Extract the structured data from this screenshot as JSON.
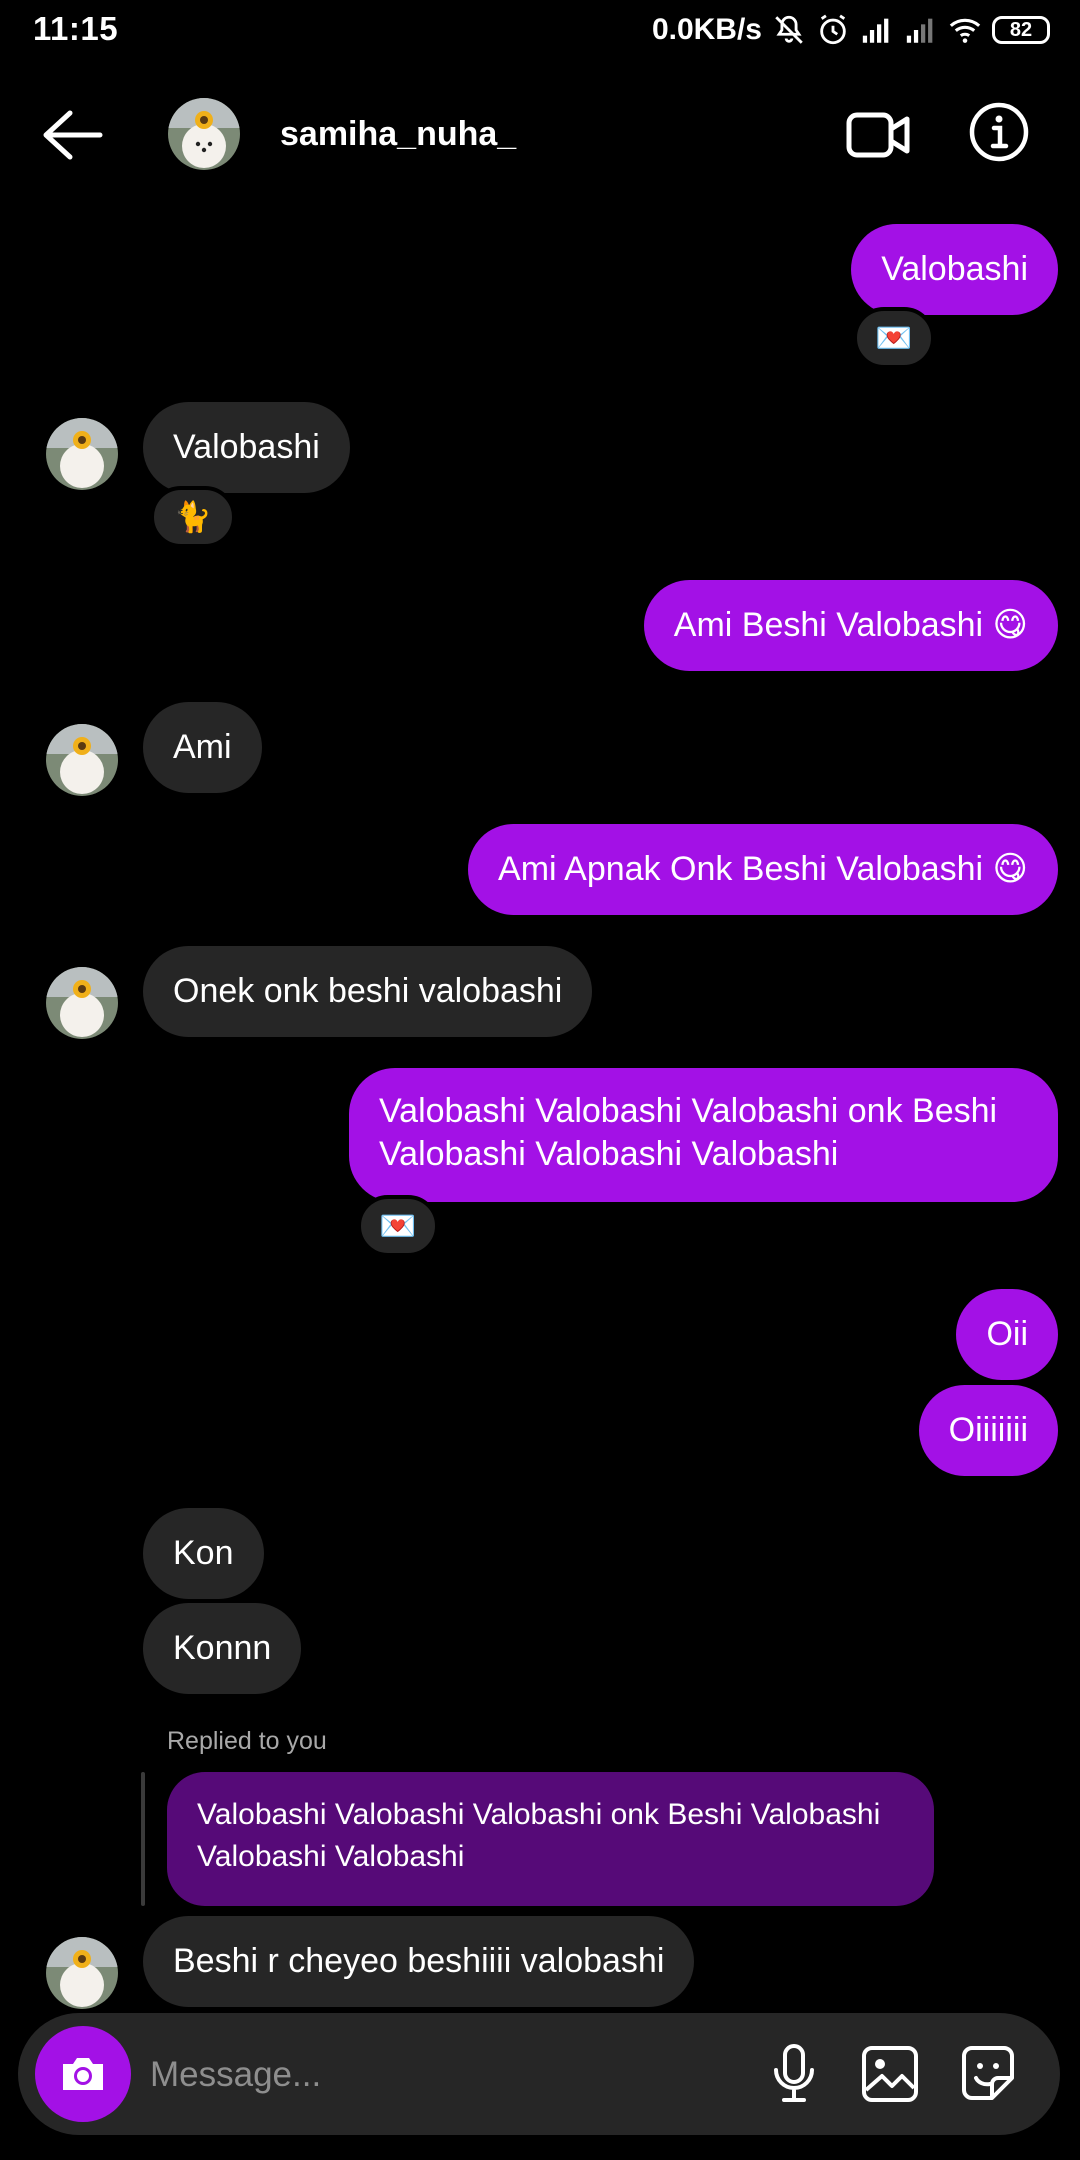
{
  "status_bar": {
    "time": "11:15",
    "net_speed": "0.0KB/s",
    "battery": "82"
  },
  "header": {
    "username": "samiha_nuha_",
    "icons": [
      "back-arrow-icon",
      "video-call-icon",
      "info-icon"
    ]
  },
  "messages": [
    {
      "id": 1,
      "direction": "outgoing",
      "text": "Valobashi",
      "reaction": "💌"
    },
    {
      "id": 2,
      "direction": "incoming",
      "text": "Valobashi",
      "reaction": "🐈"
    },
    {
      "id": 3,
      "direction": "outgoing",
      "text": "Ami Beshi Valobashi 😋"
    },
    {
      "id": 4,
      "direction": "incoming",
      "text": "Ami"
    },
    {
      "id": 5,
      "direction": "outgoing",
      "text": "Ami Apnak Onk Beshi Valobashi 😋"
    },
    {
      "id": 6,
      "direction": "incoming",
      "text": "Onek onk beshi valobashi"
    },
    {
      "id": 7,
      "direction": "outgoing",
      "text": "Valobashi Valobashi Valobashi onk Beshi Valobashi Valobashi Valobashi",
      "reaction": "💌"
    },
    {
      "id": 8,
      "direction": "outgoing",
      "text": "Oii"
    },
    {
      "id": 9,
      "direction": "outgoing",
      "text": "Oiiiiiii"
    },
    {
      "id": 10,
      "direction": "incoming",
      "text": "Kon"
    },
    {
      "id": 11,
      "direction": "incoming",
      "text": "Konnn"
    },
    {
      "id": 12,
      "direction": "incoming",
      "text": "Beshi r cheyeo beshiiii valobashi",
      "reply": {
        "label": "Replied to you",
        "quoted_text": "Valobashi Valobashi Valobashi onk Beshi Valobashi Valobashi Valobashi"
      }
    }
  ],
  "composer": {
    "placeholder": "Message..."
  },
  "colors": {
    "outgoing_bubble": "#a311e6",
    "incoming_bubble": "#262626",
    "reply_quote": "#560a78",
    "background": "#000000"
  }
}
